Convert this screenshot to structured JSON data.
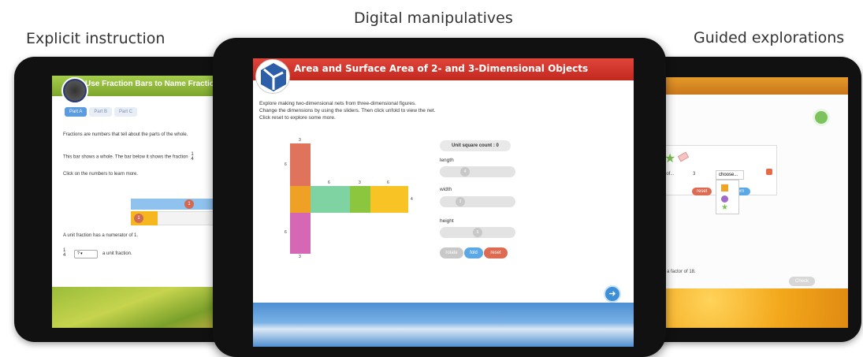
{
  "captions": {
    "left": "Explicit instruction",
    "center": "Digital manipulatives",
    "right": "Guided explorations"
  },
  "left_screen": {
    "title": "Use Fraction Bars to Name Fractio",
    "tabs": [
      "Part A",
      "Part B",
      "Part C"
    ],
    "paragraphs": [
      "Fractions are numbers that tell about the parts of the whole.",
      "This bar shows a whole. The bar below it shows the fraction",
      "Click on the numbers to learn more.",
      "A unit fraction has a numerator of 1."
    ],
    "fraction_num": "1",
    "fraction_den": "4",
    "dot_top": "1",
    "dot_mid": "1",
    "select_value": "?",
    "select_suffix": "a unit fraction."
  },
  "center_screen": {
    "title": "Area and Surface Area of 2- and 3-Dimensional Objects",
    "instructions": [
      "Explore making two-dimensional nets from three-dimensional figures.",
      "Change the dimensions by using the sliders. Then click unfold to view the net.",
      "Click reset to explore some more."
    ],
    "net_labels": {
      "top": "3",
      "left_top": "6",
      "left_bottom": "6",
      "bottom": "3",
      "face2": "6",
      "face3": "3",
      "face4": "6",
      "right": "4"
    },
    "unit_count_label": "Unit square count : 0",
    "sliders": [
      {
        "label": "length",
        "value": "4"
      },
      {
        "label": "width",
        "value": "3"
      },
      {
        "label": "height",
        "value": "6"
      }
    ],
    "buttons": {
      "rotate": "rotate",
      "fold": "fold",
      "reset": "reset"
    },
    "next_arrow": "➜",
    "colors": {
      "header": "#d1352b",
      "face_top": "#e0735c",
      "face_front": "#eea124",
      "face_green": "#7fd3a3",
      "face_lime": "#8cc63f",
      "face_yellow": "#f7c325",
      "face_pink": "#d667b4"
    }
  },
  "right_screen": {
    "row_text": "les of...",
    "row_num": "3",
    "choose": "choose...",
    "reset": "reset",
    "log_pattern": "log pattern",
    "factor_text": "a factor of 18.",
    "check": "Check"
  }
}
